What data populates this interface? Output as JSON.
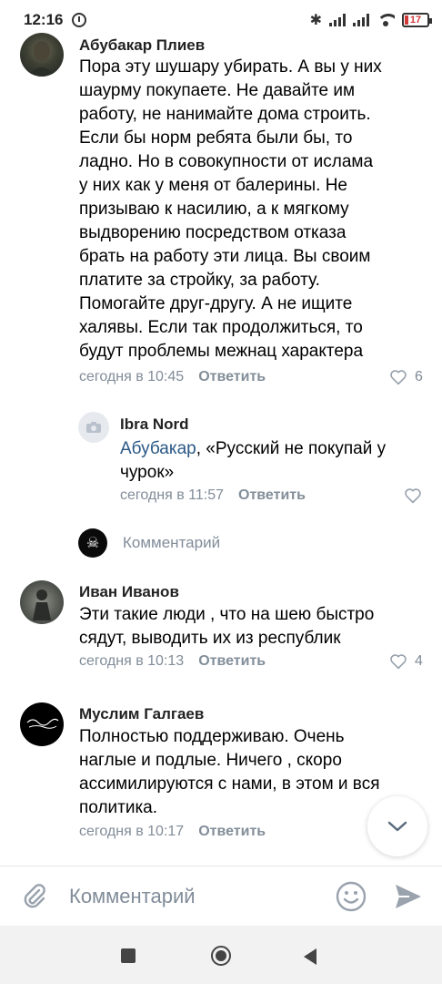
{
  "status_bar": {
    "time": "12:16",
    "battery": "17"
  },
  "comments": [
    {
      "author": "Абубакар Плиев",
      "lines": [
        "Пора эту шушару убирать. А вы у них",
        "шаурму покупаете. Не давайте им",
        "работу, не нанимайте дома строить.",
        "Если бы норм ребята были бы, то",
        "ладно. Но в совокупности от ислама",
        "у них как у меня от балерины. Не",
        "призываю к насилию, а к мягкому",
        "выдворению посредством отказа",
        "брать на работу эти лица. Вы своим",
        "платите за стройку, за работу.",
        "Помогайте друг-другу. А не ищите",
        "халявы. Если так продолжиться, то",
        "будут проблемы межнац характера"
      ],
      "time": "сегодня в 10:45",
      "reply_label": "Ответить",
      "likes": "6"
    },
    {
      "author": "Ibra Nord",
      "mention": "Абубакар",
      "text_line1": ", «Русский не покупай у",
      "text_line2": "чурок»",
      "time": "сегодня в 11:57",
      "reply_label": "Ответить",
      "likes": ""
    },
    {
      "author": "Иван Иванов",
      "lines": [
        "Эти такие люди , что на шею быстро",
        "сядут, выводить их из республик"
      ],
      "time": "сегодня в 10:13",
      "reply_label": "Ответить",
      "likes": "4"
    },
    {
      "author": "Муслим Галгаев",
      "lines": [
        "Полностью поддерживаю. Очень",
        "наглые и подлые. Ничего , скоро",
        "ассимилируются с нами, в этом и вся",
        "политика."
      ],
      "time": "сегодня в 10:17",
      "reply_label": "Ответить",
      "likes": ""
    }
  ],
  "inline_reply": {
    "placeholder": "Комментарий"
  },
  "composer": {
    "placeholder": "Комментарий"
  },
  "colors": {
    "meta": "#818c99",
    "mention": "#2a5885",
    "icon": "#99a2ad"
  }
}
